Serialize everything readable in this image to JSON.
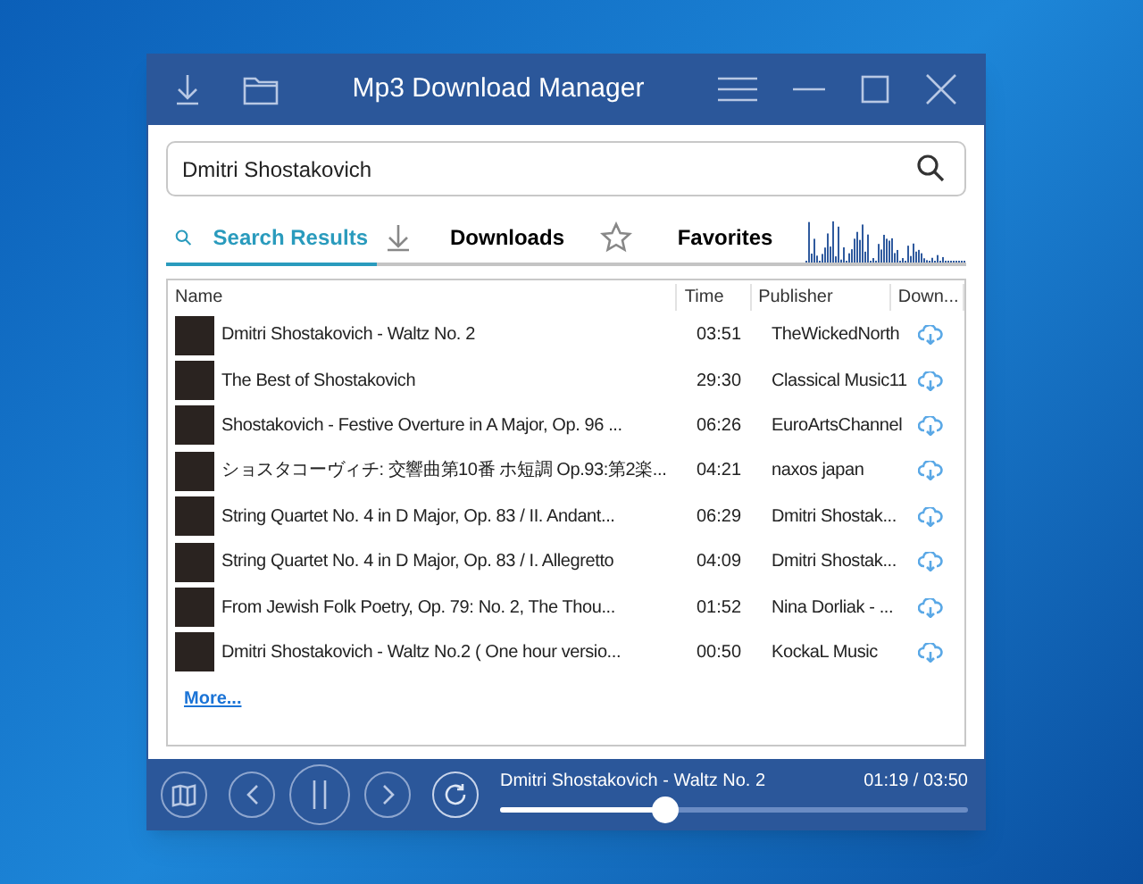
{
  "window": {
    "title": "Mp3 Download Manager"
  },
  "search": {
    "value": "Dmitri Shostakovich"
  },
  "tabs": [
    {
      "label": "Search Results",
      "kind": "search",
      "selected": true
    },
    {
      "label": "Downloads",
      "kind": "download",
      "selected": false
    },
    {
      "label": "Favorites",
      "kind": "star",
      "selected": false
    }
  ],
  "table": {
    "columns": [
      "Name",
      "Time",
      "Publisher",
      "Down..."
    ],
    "rows": [
      {
        "name": "Dmitri Shostakovich -  Waltz No. 2",
        "time": "03:51",
        "publisher": "TheWickedNorth"
      },
      {
        "name": "The Best of Shostakovich",
        "time": "29:30",
        "publisher": "Classical Music11"
      },
      {
        "name": "Shostakovich - Festive Overture in A Major, Op. 96 ...",
        "time": "06:26",
        "publisher": "EuroArtsChannel"
      },
      {
        "name": "ショスタコーヴィチ: 交響曲第10番 ホ短調 Op.93:第2楽...",
        "time": "04:21",
        "publisher": "naxos japan"
      },
      {
        "name": "String Quartet No. 4 in D Major, Op. 83 / II. Andant...",
        "time": "06:29",
        "publisher": "Dmitri Shostak..."
      },
      {
        "name": "String Quartet No. 4 in D Major, Op. 83 / I. Allegretto",
        "time": "04:09",
        "publisher": "Dmitri Shostak..."
      },
      {
        "name": "From Jewish Folk Poetry, Op. 79: No. 2, The Thou...",
        "time": "01:52",
        "publisher": "Nina Dorliak - ..."
      },
      {
        "name": "Dmitri Shostakovich - Waltz No.2 ( One hour versio...",
        "time": "00:50",
        "publisher": "KockaL Music"
      }
    ],
    "more_link": "More..."
  },
  "player": {
    "track": "Dmitri Shostakovich -  Waltz No. 2",
    "time": "01:19 / 03:50",
    "playing": true,
    "level": 0.35
  }
}
